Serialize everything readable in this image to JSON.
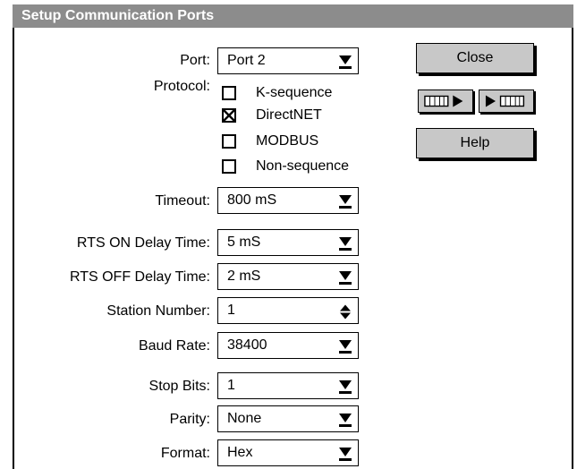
{
  "dialog": {
    "title": "Setup Communication Ports"
  },
  "fields": {
    "port": {
      "label": "Port:",
      "value": "Port 2"
    },
    "protocol": {
      "label": "Protocol:",
      "options": [
        {
          "label": "K-sequence",
          "checked": false
        },
        {
          "label": "DirectNET",
          "checked": true
        },
        {
          "label": "MODBUS",
          "checked": false
        },
        {
          "label": "Non-sequence",
          "checked": false
        }
      ]
    },
    "timeout": {
      "label": "Timeout:",
      "value": "800 mS"
    },
    "rts_on": {
      "label": "RTS ON Delay Time:",
      "value": "5 mS"
    },
    "rts_off": {
      "label": "RTS OFF Delay Time:",
      "value": "2 mS"
    },
    "station": {
      "label": "Station Number:",
      "value": "1"
    },
    "baud": {
      "label": "Baud Rate:",
      "value": "38400"
    },
    "stop_bits": {
      "label": "Stop Bits:",
      "value": "1"
    },
    "parity": {
      "label": "Parity:",
      "value": "None"
    },
    "format": {
      "label": "Format:",
      "value": "Hex"
    }
  },
  "buttons": {
    "close": "Close",
    "help": "Help",
    "read_from_plc_icon": "plc-to-pc-icon",
    "write_to_plc_icon": "pc-to-plc-icon"
  },
  "colors": {
    "title_bar": "#8c8c8c",
    "button_face": "#c8c8c8"
  }
}
